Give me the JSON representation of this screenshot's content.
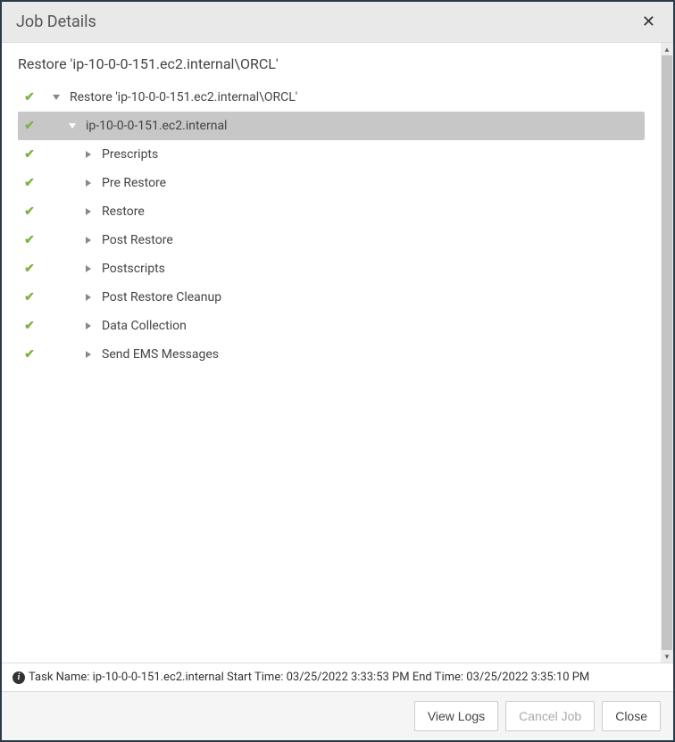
{
  "header": {
    "title": "Job Details"
  },
  "subtitle": "Restore 'ip-10-0-0-151.ec2.internal\\ORCL'",
  "tree": [
    {
      "level": 0,
      "expanded": true,
      "selected": false,
      "status": "success",
      "label": "Restore 'ip-10-0-0-151.ec2.internal\\ORCL'"
    },
    {
      "level": 1,
      "expanded": true,
      "selected": true,
      "status": "success",
      "label": "ip-10-0-0-151.ec2.internal"
    },
    {
      "level": 2,
      "expanded": false,
      "selected": false,
      "status": "success",
      "label": "Prescripts"
    },
    {
      "level": 2,
      "expanded": false,
      "selected": false,
      "status": "success",
      "label": "Pre Restore"
    },
    {
      "level": 2,
      "expanded": false,
      "selected": false,
      "status": "success",
      "label": "Restore"
    },
    {
      "level": 2,
      "expanded": false,
      "selected": false,
      "status": "success",
      "label": "Post Restore"
    },
    {
      "level": 2,
      "expanded": false,
      "selected": false,
      "status": "success",
      "label": "Postscripts"
    },
    {
      "level": 2,
      "expanded": false,
      "selected": false,
      "status": "success",
      "label": "Post Restore Cleanup"
    },
    {
      "level": 2,
      "expanded": false,
      "selected": false,
      "status": "success",
      "label": "Data Collection"
    },
    {
      "level": 2,
      "expanded": false,
      "selected": false,
      "status": "success",
      "label": "Send EMS Messages"
    }
  ],
  "status_bar": {
    "text": "Task Name: ip-10-0-0-151.ec2.internal Start Time: 03/25/2022 3:33:53 PM End Time: 03/25/2022 3:35:10 PM"
  },
  "footer": {
    "view_logs": "View Logs",
    "cancel_job": "Cancel Job",
    "close": "Close"
  }
}
